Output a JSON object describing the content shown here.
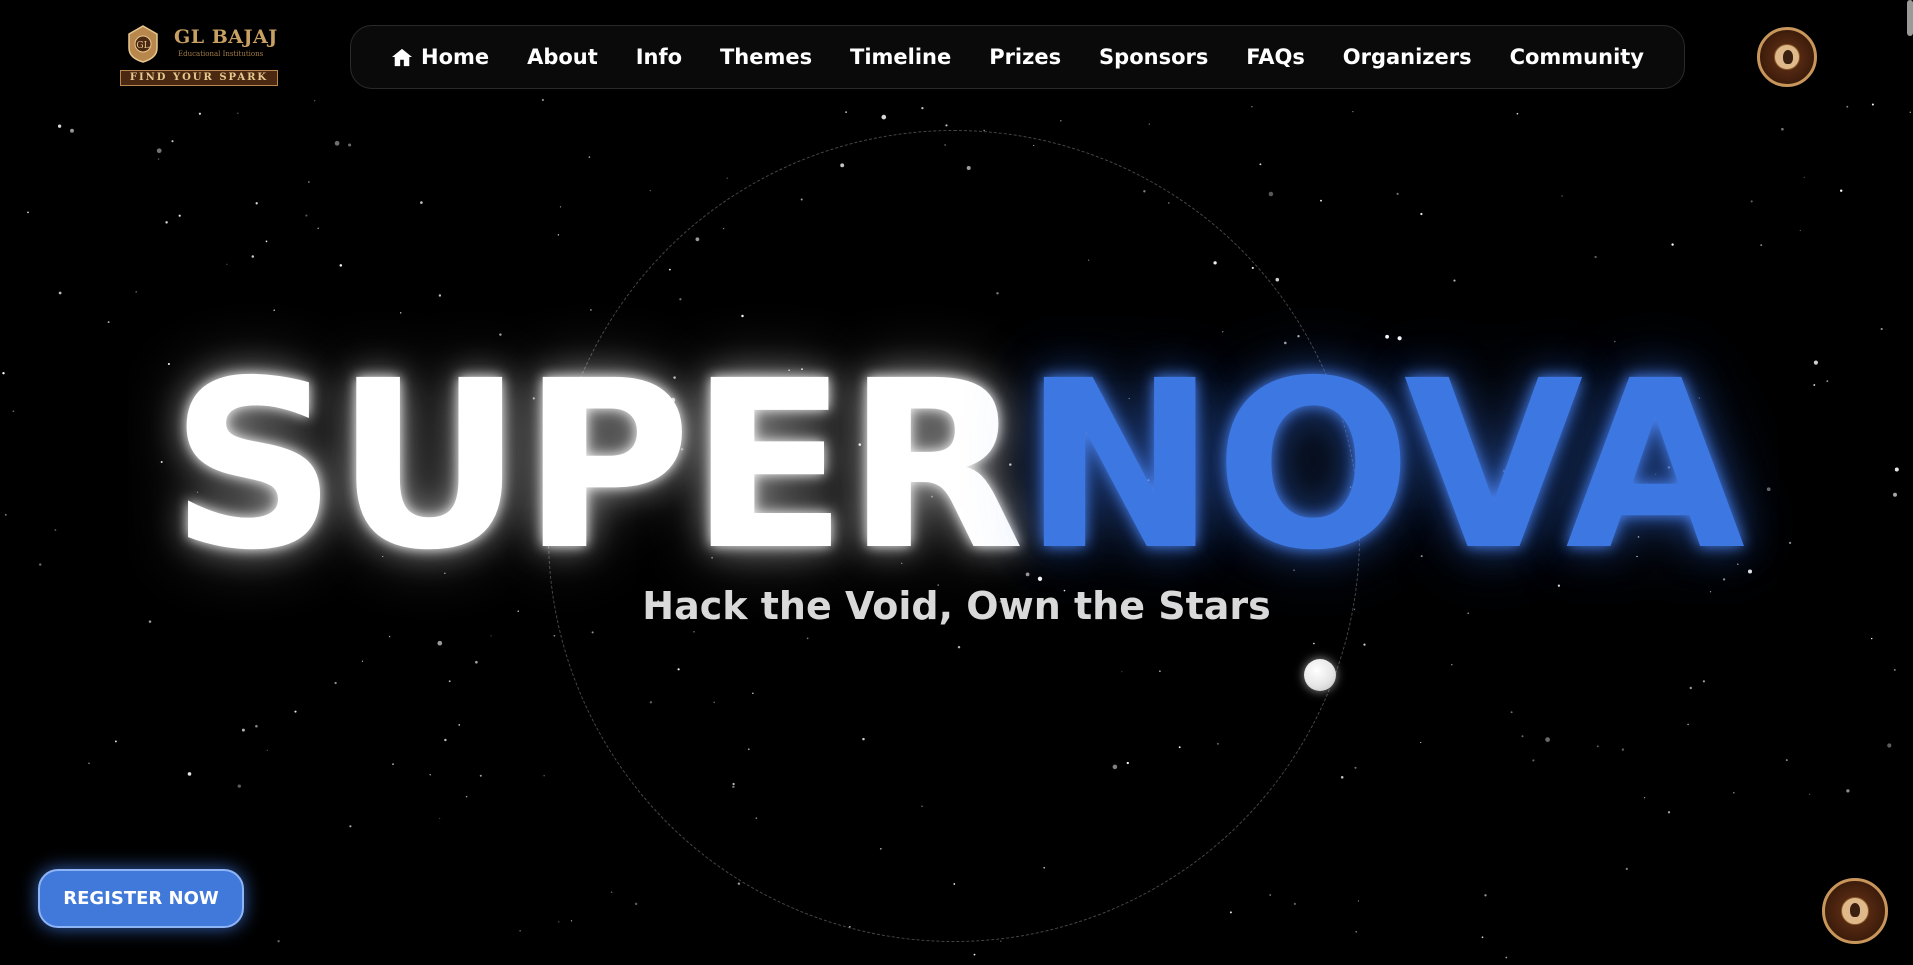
{
  "logo_left": {
    "brand": "GL BAJAJ",
    "subtitle": "Educational Institutions",
    "tagline": "FIND YOUR SPARK"
  },
  "nav": {
    "items": [
      {
        "label": "Home",
        "icon": "home-icon"
      },
      {
        "label": "About"
      },
      {
        "label": "Info"
      },
      {
        "label": "Themes"
      },
      {
        "label": "Timeline"
      },
      {
        "label": "Prizes"
      },
      {
        "label": "Sponsors"
      },
      {
        "label": "FAQs"
      },
      {
        "label": "Organizers"
      },
      {
        "label": "Community"
      }
    ]
  },
  "hero": {
    "title_part1": "SUPER",
    "title_part2": "NOVA",
    "tagline": "Hack the Void, Own the Stars"
  },
  "cta": {
    "register_label": "REGISTER NOW"
  },
  "colors": {
    "background": "#000000",
    "accent_blue": "#3d78e2",
    "button_blue": "#4079d9",
    "logo_gold": "#c9a063",
    "logo_brown": "#4a2812"
  }
}
